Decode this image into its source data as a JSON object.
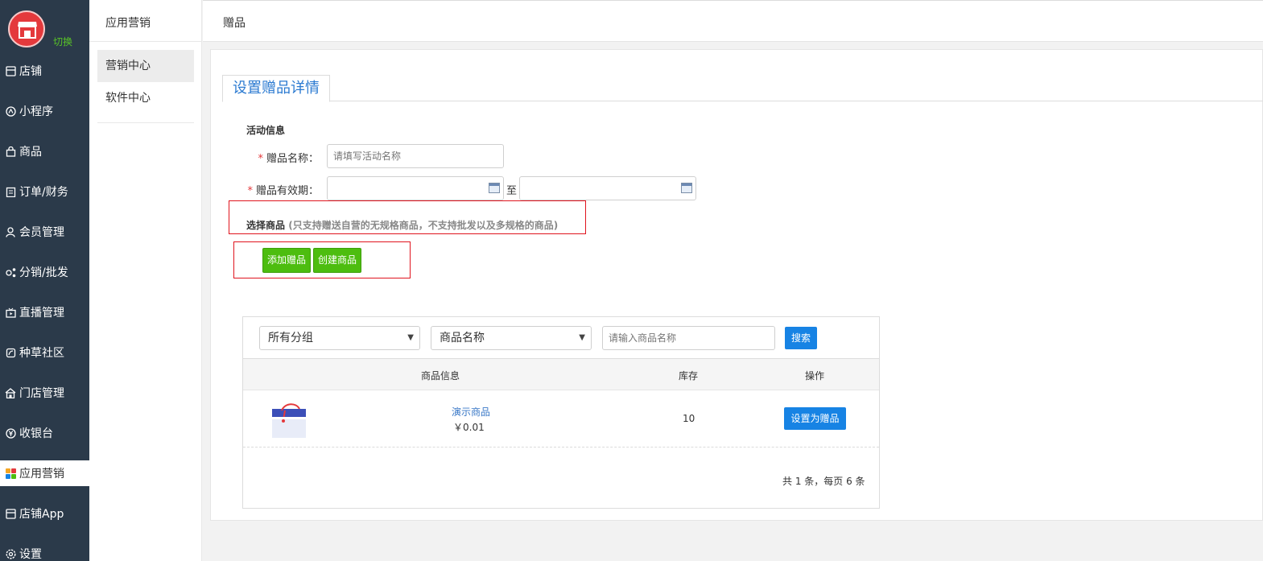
{
  "sidebar": {
    "switch_label": "切换",
    "items": [
      {
        "label": "店铺",
        "icon": "store-icon"
      },
      {
        "label": "小程序",
        "icon": "mini-program-icon"
      },
      {
        "label": "商品",
        "icon": "bag-icon"
      },
      {
        "label": "订单/财务",
        "icon": "clipboard-icon"
      },
      {
        "label": "会员管理",
        "icon": "member-icon"
      },
      {
        "label": "分销/批发",
        "icon": "share-icon"
      },
      {
        "label": "直播管理",
        "icon": "live-icon"
      },
      {
        "label": "种草社区",
        "icon": "community-icon"
      },
      {
        "label": "门店管理",
        "icon": "shop-house-icon"
      },
      {
        "label": "收银台",
        "icon": "yen-icon"
      },
      {
        "label": "应用营销",
        "icon": "apps-icon",
        "active": true
      },
      {
        "label": "店铺App",
        "icon": "store-app-icon"
      },
      {
        "label": "设置",
        "icon": "settings-icon"
      }
    ],
    "accent_color": "#e4393c"
  },
  "subnav": {
    "title": "应用营销",
    "items": [
      {
        "label": "营销中心",
        "active": true
      },
      {
        "label": "软件中心"
      }
    ]
  },
  "header": {
    "title": "赠品"
  },
  "form": {
    "tab_label": "设置赠品详情",
    "section_activity": "活动信息",
    "name_label": "赠品名称：",
    "name_placeholder": "请填写活动名称",
    "validity_label": "赠品有效期：",
    "validity_start": "",
    "validity_end": "",
    "to_label": "至",
    "section_goods": "选择商品",
    "goods_hint": "(只支持赠送自营的无规格商品，不支持批发以及多规格的商品)",
    "add_gift_button": "添加赠品",
    "create_goods_button": "创建商品",
    "required_mark": "*"
  },
  "picker": {
    "group_select": "所有分组",
    "field_select": "商品名称",
    "search_placeholder": "请输入商品名称",
    "search_button": "搜索",
    "columns": [
      "商品信息",
      "库存",
      "操作"
    ],
    "rows": [
      {
        "name": "演示商品",
        "price": "￥0.01",
        "stock": "10",
        "action": "设置为赠品"
      }
    ],
    "pagination": "共 1 条，每页 6 条"
  },
  "colors": {
    "sidebar_bg": "#2b3a4a",
    "green_button": "#4dbd0f",
    "blue_button": "#1783e4",
    "highlight_box": "#e0141e",
    "link": "#3a78c7"
  }
}
